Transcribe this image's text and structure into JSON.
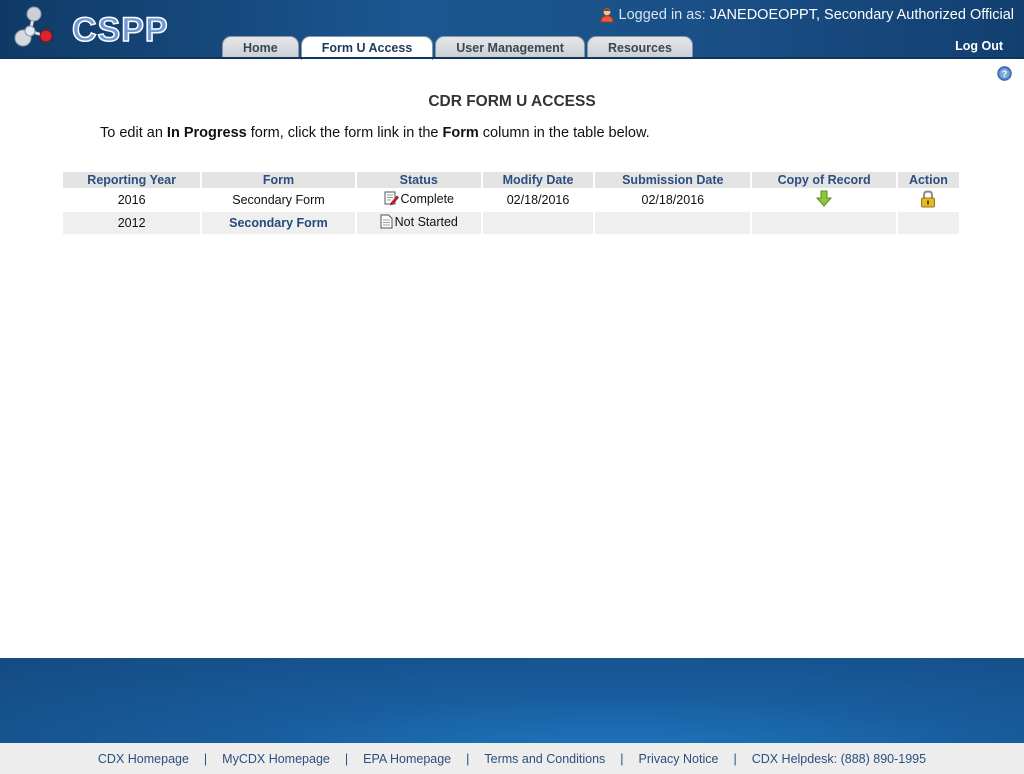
{
  "header": {
    "app_name": "CSPP",
    "logged_in_label": "Logged in as:",
    "user": "JANEDOEOPPT, Secondary Authorized Official",
    "logout_label": "Log Out",
    "tabs": [
      {
        "label": "Home",
        "active": false
      },
      {
        "label": "Form U Access",
        "active": true
      },
      {
        "label": "User Management",
        "active": false
      },
      {
        "label": "Resources",
        "active": false
      }
    ]
  },
  "main": {
    "title": "CDR FORM U ACCESS",
    "instructions": {
      "prefix": "To edit an ",
      "bold1": "In Progress",
      "middle": " form, click the form link in the ",
      "bold2": "Form",
      "suffix": " column in the table below."
    },
    "table": {
      "columns": [
        "Reporting Year",
        "Form",
        "Status",
        "Modify Date",
        "Submission Date",
        "Copy of Record",
        "Action"
      ],
      "rows": [
        {
          "year": "2016",
          "form": "Secondary Form",
          "form_is_link": false,
          "status": "Complete",
          "status_icon": "edit-document-icon",
          "modify_date": "02/18/2016",
          "submission_date": "02/18/2016",
          "copy_icon": "download-arrow-icon",
          "action_icon": "lock-icon"
        },
        {
          "year": "2012",
          "form": "Secondary Form",
          "form_is_link": true,
          "status": "Not Started",
          "status_icon": "document-icon",
          "modify_date": "",
          "submission_date": "",
          "copy_icon": "",
          "action_icon": ""
        }
      ]
    }
  },
  "footer": {
    "links": [
      "CDX Homepage",
      "MyCDX Homepage",
      "EPA Homepage",
      "Terms and Conditions",
      "Privacy Notice",
      "CDX Helpdesk: (888) 890-1995"
    ],
    "separator": "|"
  },
  "colors": {
    "header_blue": "#1c5690",
    "link_blue": "#2b4f7e",
    "table_header_bg": "#e4e4e4",
    "download_green": "#8cc63f",
    "lock_gold": "#e0b020"
  }
}
